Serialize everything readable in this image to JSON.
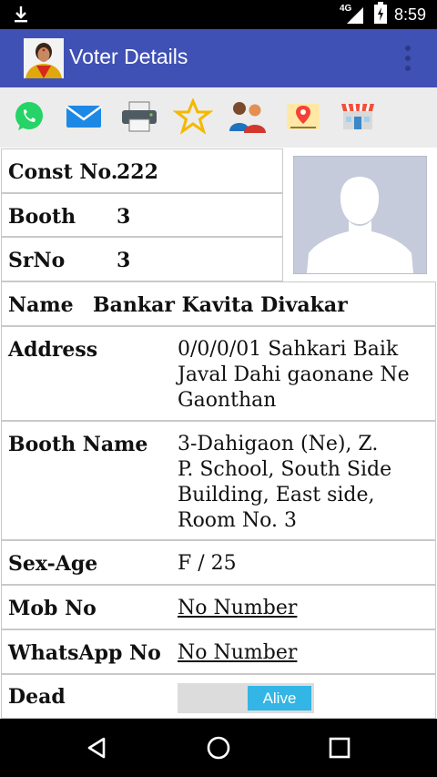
{
  "status_bar": {
    "time": "8:59",
    "network": "4G",
    "download_icon": "download-icon",
    "signal_icon": "signal-icon",
    "battery_icon": "battery-charging-icon"
  },
  "app_bar": {
    "title": "Voter Details",
    "avatar_icon": "profile-avatar",
    "menu_icon": "overflow-menu-icon",
    "color": "#3f51b5"
  },
  "toolbar": {
    "icons": [
      "whatsapp-icon",
      "email-icon",
      "printer-icon",
      "star-icon",
      "family-icon",
      "voter-address-icon",
      "voter-booth-icon"
    ]
  },
  "voter": {
    "const_label": "Const No.",
    "const_value": "222",
    "booth_label": "Booth",
    "booth_value": "3",
    "srno_label": "SrNo",
    "srno_value": "3",
    "name_label": "Name",
    "name_value": "Bankar Kavita Divakar",
    "address_label": "Address",
    "address_value": [
      "0/0/0/01 Sahkari Baik",
      "Javal Dahi gaonane Ne",
      "Gaonthan"
    ],
    "booth_name_label": "Booth Name",
    "booth_name_value": [
      "3-Dahigaon (Ne), Z.",
      "P. School, South Side",
      "Building, East side,",
      "Room No. 3"
    ],
    "sex_age_label": "Sex-Age",
    "sex_age_value": "F / 25",
    "mob_label": "Mob No",
    "mob_value": "No Number",
    "whatsapp_label": "WhatsApp No",
    "whatsapp_value": "No Number",
    "dead_label": "Dead",
    "dead_toggle_value": "Alive",
    "toggle_color": "#33b5e5"
  },
  "nav": {
    "back_icon": "back-icon",
    "home_icon": "home-icon",
    "recents_icon": "recents-icon"
  }
}
